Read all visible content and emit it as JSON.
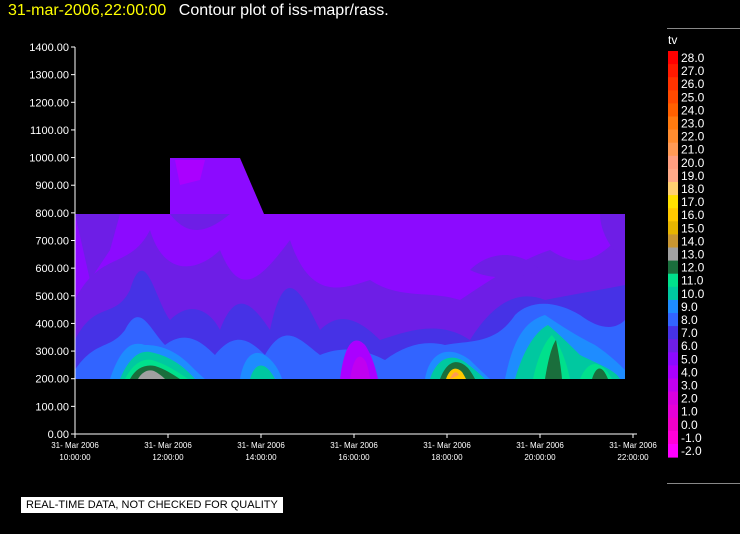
{
  "title": {
    "timestamp": "31-mar-2006,22:00:00",
    "text": "Contour plot of iss-mapr/rass."
  },
  "disclaimer": "REAL-TIME DATA, NOT CHECKED FOR QUALITY",
  "chart_data": {
    "type": "contour",
    "ylim": [
      0,
      1400
    ],
    "y_ticks": [
      "0.00",
      "100.00",
      "200.00",
      "300.00",
      "400.00",
      "500.00",
      "600.00",
      "700.00",
      "800.00",
      "900.00",
      "1000.00",
      "1100.00",
      "1200.00",
      "1300.00",
      "1400.00"
    ],
    "x_ticks": [
      {
        "date": "31- Mar 2006",
        "time": "10:00:00"
      },
      {
        "date": "31- Mar 2006",
        "time": "12:00:00"
      },
      {
        "date": "31- Mar 2006",
        "time": "14:00:00"
      },
      {
        "date": "31- Mar 2006",
        "time": "16:00:00"
      },
      {
        "date": "31- Mar 2006",
        "time": "18:00:00"
      },
      {
        "date": "31- Mar 2006",
        "time": "20:00:00"
      },
      {
        "date": "31- Mar 2006",
        "time": "22:00:00"
      }
    ],
    "x_range": [
      "31-mar-2006 10:00:00",
      "31-mar-2006 22:00:00"
    ],
    "legend": {
      "title": "tv",
      "levels": [
        "28.0",
        "27.0",
        "26.0",
        "25.0",
        "24.0",
        "23.0",
        "22.0",
        "21.0",
        "20.0",
        "19.0",
        "18.0",
        "17.0",
        "16.0",
        "15.0",
        "14.0",
        "13.0",
        "12.0",
        "11.0",
        "10.0",
        "9.0",
        "8.0",
        "7.0",
        "6.0",
        "5.0",
        "4.0",
        "3.0",
        "2.0",
        "1.0",
        "0.0",
        "-1.0",
        "-2.0"
      ],
      "colors": [
        "#ff0000",
        "#ff1a00",
        "#ff3300",
        "#ff4a00",
        "#ff6000",
        "#ff7a10",
        "#ff8c30",
        "#ff9a55",
        "#ff9f80",
        "#ffaa88",
        "#ffd070",
        "#ffe000",
        "#ffc800",
        "#e6b400",
        "#c89632",
        "#a0a0a0",
        "#1a6e3c",
        "#00e08c",
        "#00c8a0",
        "#1e8cff",
        "#3264ff",
        "#4632e6",
        "#6e1ee6",
        "#8c0aff",
        "#aa00ff",
        "#c000f0",
        "#d800e0",
        "#e600d8",
        "#f000c8",
        "#ff00d8",
        "#ff00ff"
      ]
    },
    "data_extent": {
      "default_ylim": [
        200,
        800
      ],
      "extended_top": {
        "x": [
          "11:45:00",
          "14:10:00"
        ],
        "y": 1000
      }
    }
  }
}
